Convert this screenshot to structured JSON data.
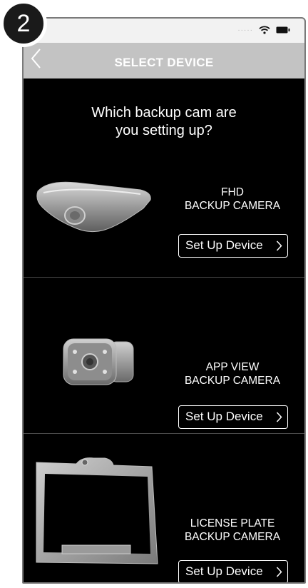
{
  "step_number": "2",
  "nav": {
    "title": "SELECT DEVICE"
  },
  "question": {
    "line1": "Which backup cam are",
    "line2": "you setting up?"
  },
  "devices": [
    {
      "name_line1": "FHD",
      "name_line2": "BACKUP CAMERA",
      "button_label": "Set Up Device"
    },
    {
      "name_line1": "APP VIEW",
      "name_line2": "BACKUP CAMERA",
      "button_label": "Set Up Device"
    },
    {
      "name_line1": "LICENSE PLATE",
      "name_line2": "BACKUP CAMERA",
      "button_label": "Set Up Device"
    }
  ],
  "colors": {
    "background": "#000000",
    "nav_bar": "#c3c3c3",
    "status_bar": "#f2f2f2",
    "text": "#ffffff"
  },
  "icons": {
    "back": "chevron-left-icon",
    "wifi": "wifi-icon",
    "battery": "battery-icon",
    "chevron": "chevron-right-icon"
  }
}
